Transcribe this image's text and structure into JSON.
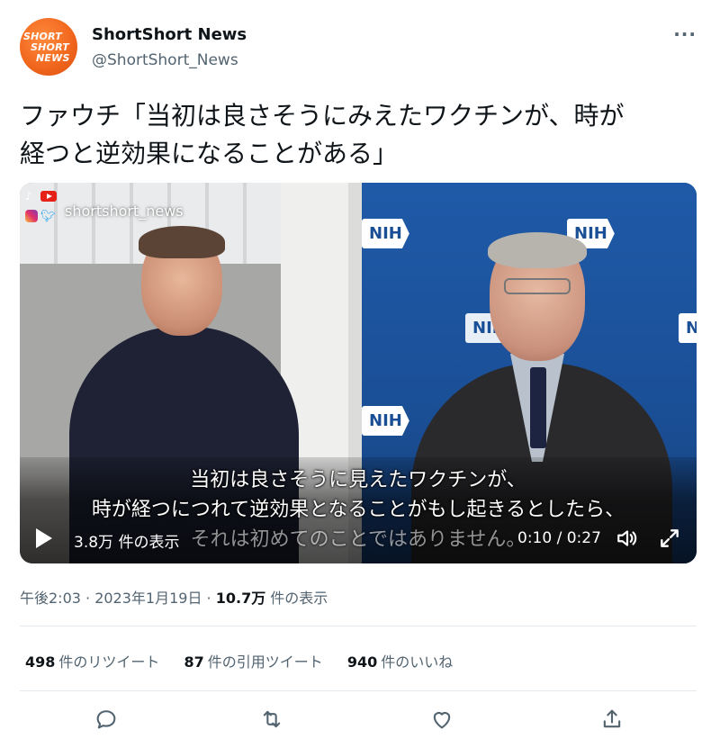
{
  "account": {
    "logo_lines": [
      "SHORT",
      "SHORT",
      "NEWS"
    ],
    "name": "ShortShort News",
    "handle": "@ShortShort_News",
    "more_label": "···"
  },
  "tweet": {
    "text_line1": "ファウチ「当初は良さそうにみえたワクチンが、時が",
    "text_line2": "経つと逆効果になることがある」"
  },
  "video": {
    "watermark": "shortshort_news",
    "logo_left": "NIH",
    "logo_right": "NIH",
    "logo_bottom": "NIH",
    "logo_partial": "N",
    "subtitle_line1": "当初は良さそうに見えたワクチンが、",
    "subtitle_line2": "時が経つにつれて逆効果となることがもし起きるとしたら、",
    "subtitle_line3": "それは初めてのことではありません。",
    "views": "3.8万 件の表示",
    "time": "0:10 / 0:27"
  },
  "meta": {
    "time": "午後2:03 · 2023年1月19日 · ",
    "views_count": "10.7万",
    "views_label": " 件の表示"
  },
  "stats": {
    "retweets_count": "498",
    "retweets_label": "件のリツイート",
    "quotes_count": "87",
    "quotes_label": "件の引用ツイート",
    "likes_count": "940",
    "likes_label": "件のいいね"
  },
  "icons": {
    "reply": "reply-icon",
    "retweet": "retweet-icon",
    "like": "like-icon",
    "share": "share-icon"
  },
  "colors": {
    "brand_orange": "#f0651c",
    "text_primary": "#0f1419",
    "text_secondary": "#536471",
    "nih_blue": "#1a4f96"
  }
}
